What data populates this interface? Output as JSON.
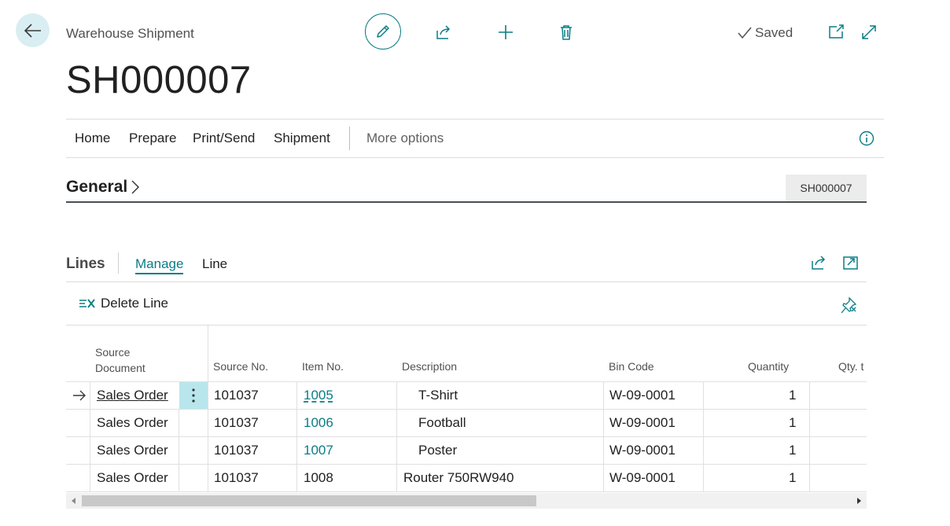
{
  "header": {
    "breadcrumb": "Warehouse Shipment",
    "title": "SH000007",
    "status": "Saved",
    "icons": [
      "back-arrow-icon",
      "edit-pencil-icon",
      "share-icon",
      "plus-icon",
      "delete-trash-icon",
      "checkmark-icon",
      "open-new-window-icon",
      "expand-icon"
    ]
  },
  "actions": {
    "menus": [
      "Home",
      "Prepare",
      "Print/Send",
      "Shipment"
    ],
    "more": "More options"
  },
  "general": {
    "title": "General",
    "badge": "SH000007"
  },
  "lines": {
    "title": "Lines",
    "tabs": [
      "Manage",
      "Line"
    ],
    "delete_line": "Delete Line",
    "columns": {
      "source_document": [
        "Source",
        "Document"
      ],
      "source_no": "Source No.",
      "item_no": "Item No.",
      "description": "Description",
      "bin_code": "Bin Code",
      "quantity": "Quantity",
      "qty_truncated": "Qty. t"
    },
    "rows": [
      {
        "source_document": "Sales Order",
        "source_no": "101037",
        "item_no": "1005",
        "description": "T-Shirt",
        "bin_code": "W-09-0001",
        "quantity": "1"
      },
      {
        "source_document": "Sales Order",
        "source_no": "101037",
        "item_no": "1006",
        "description": "Football",
        "bin_code": "W-09-0001",
        "quantity": "1"
      },
      {
        "source_document": "Sales Order",
        "source_no": "101037",
        "item_no": "1007",
        "description": "Poster",
        "bin_code": "W-09-0001",
        "quantity": "1"
      },
      {
        "source_document": "Sales Order",
        "source_no": "101037",
        "item_no": "1008",
        "description": "Router 750RW940",
        "bin_code": "W-09-0001",
        "quantity": "1"
      }
    ]
  },
  "colors": {
    "accent": "#0a7d86",
    "back_button_bg": "#d9eef2",
    "selected_cell_bg": "#b9e6ec"
  }
}
